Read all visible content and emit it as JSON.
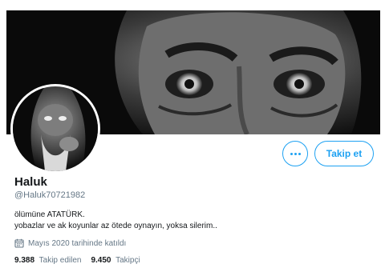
{
  "profile": {
    "name": "Haluk",
    "handle": "@Haluk70721982",
    "bio_line1": "ölümüne ATATÜRK.",
    "bio_line2": "yobazlar ve ak koyunlar az ötede oynayın, yoksa silerim..",
    "joined": "Mayıs 2020 tarihinde katıldı",
    "following_count": "9.388",
    "following_label": "Takip edilen",
    "followers_count": "9.450",
    "followers_label": "Takipçi"
  },
  "actions": {
    "follow_label": "Takip et",
    "more_icon": "more-dots-icon"
  },
  "colors": {
    "accent": "#1da1f2",
    "secondary_text": "#657786",
    "primary_text": "#14171a"
  }
}
